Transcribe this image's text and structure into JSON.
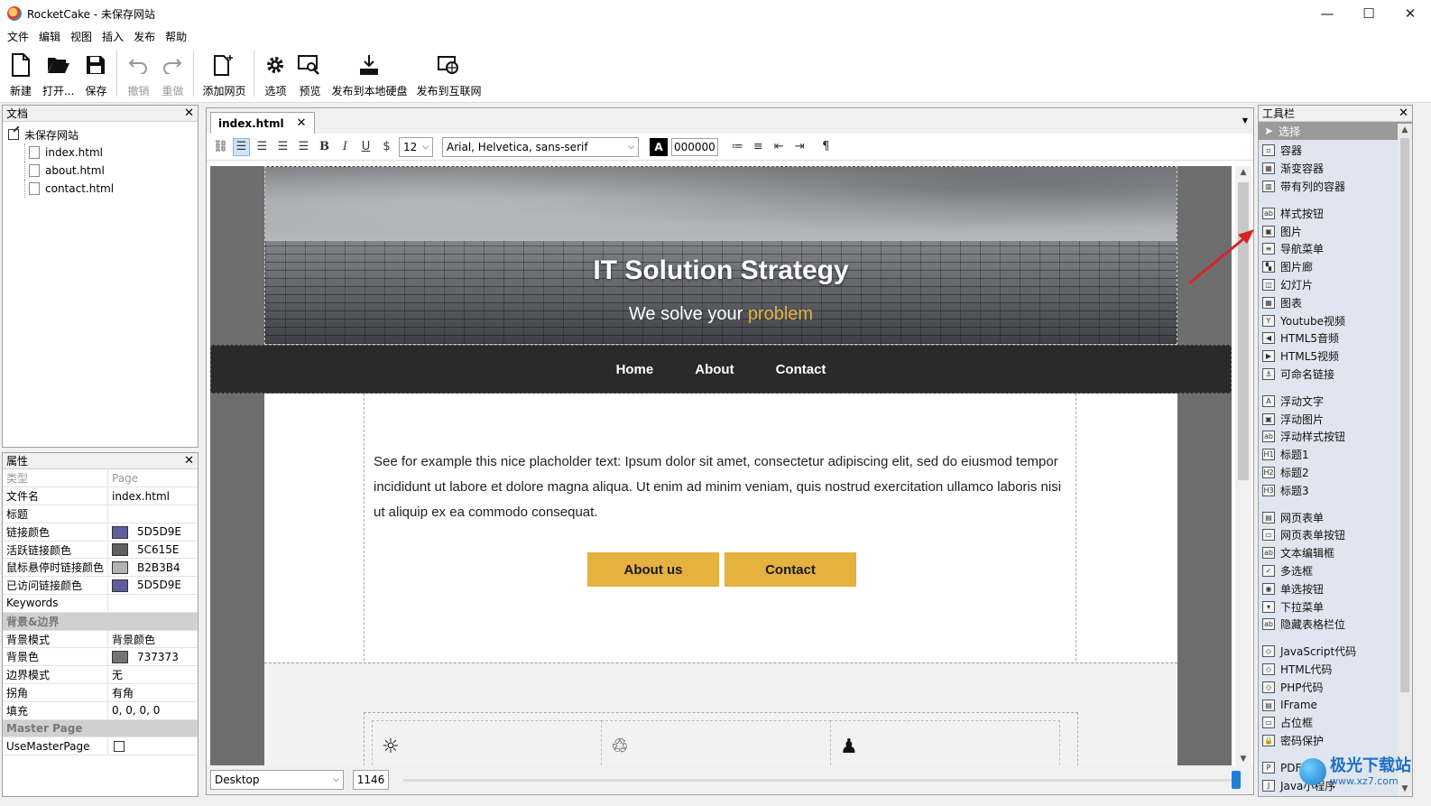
{
  "window": {
    "title": "RocketCake - 未保存网站",
    "controls": [
      "—",
      "☐",
      "✕"
    ]
  },
  "menu": [
    "文件",
    "编辑",
    "视图",
    "插入",
    "发布",
    "帮助"
  ],
  "toolbar": {
    "new": "新建",
    "open": "打开...",
    "save": "保存",
    "undo": "撤销",
    "redo": "重做",
    "add_page": "添加网页",
    "options": "选项",
    "preview": "预览",
    "publish_local": "发布到本地硬盘",
    "publish_web": "发布到互联网"
  },
  "documents_panel": {
    "title": "文档",
    "root": "未保存网站",
    "files": [
      "index.html",
      "about.html",
      "contact.html"
    ]
  },
  "properties_panel": {
    "title": "属性",
    "rows": [
      {
        "key": "类型",
        "value": "Page",
        "style": "grey"
      },
      {
        "key": "文件名",
        "value": "index.html"
      },
      {
        "key": "标题",
        "value": ""
      },
      {
        "key": "链接颜色",
        "value": "5D5D9E",
        "swatch": "#5D5D9E"
      },
      {
        "key": "活跃链接颜色",
        "value": "5C615E",
        "swatch": "#5C615E"
      },
      {
        "key": "鼠标悬停时链接颜色",
        "value": "B2B3B4",
        "swatch": "#B2B3B4"
      },
      {
        "key": "已访问链接颜色",
        "value": "5D5D9E",
        "swatch": "#5D5D9E"
      },
      {
        "key": "Keywords",
        "value": ""
      },
      {
        "key": "背景&边界",
        "value": "",
        "style": "section"
      },
      {
        "key": "背景模式",
        "value": "背景颜色"
      },
      {
        "key": "背景色",
        "value": "737373",
        "swatch": "#737373"
      },
      {
        "key": "边界模式",
        "value": "无"
      },
      {
        "key": "拐角",
        "value": "有角"
      },
      {
        "key": "填充",
        "value": "0, 0, 0, 0"
      },
      {
        "key": "Master Page",
        "value": "",
        "style": "section"
      },
      {
        "key": "UseMasterPage",
        "value": "",
        "checkbox": true
      }
    ]
  },
  "editor": {
    "tab": "index.html",
    "font_size": "12",
    "font_family": "Arial, Helvetica, sans-serif",
    "color_letter": "A",
    "color_value": "000000",
    "device": "Desktop",
    "width": "1146"
  },
  "site": {
    "hero_title": "IT Solution Strategy",
    "hero_sub_prefix": "We solve your ",
    "hero_sub_highlight": "problem",
    "nav": [
      "Home",
      "About",
      "Contact"
    ],
    "body_text": "See for example this nice placholder text: Ipsum dolor sit amet, consectetur adipiscing elit, sed do eiusmod tempor incididunt ut labore et dolore magna aliqua. Ut enim ad minim veniam, quis nostrud exercitation ullamco laboris nisi ut aliquip ex ea commodo consequat.",
    "button_about": "About us",
    "button_contact": "Contact",
    "accent_color": "#E5B13F"
  },
  "tools_panel": {
    "title": "工具栏",
    "selected": "选择",
    "groups": [
      [
        {
          "label": "容器",
          "icon": "container-icon"
        },
        {
          "label": "渐变容器",
          "icon": "gradient-container-icon"
        },
        {
          "label": "带有列的容器",
          "icon": "column-container-icon"
        }
      ],
      [
        {
          "label": "样式按钮",
          "icon": "style-button-icon"
        },
        {
          "label": "图片",
          "icon": "image-icon"
        },
        {
          "label": "导航菜单",
          "icon": "nav-menu-icon"
        },
        {
          "label": "图片廊",
          "icon": "gallery-icon"
        },
        {
          "label": "幻灯片",
          "icon": "slideshow-icon"
        },
        {
          "label": "图表",
          "icon": "table-icon"
        },
        {
          "label": "Youtube视频",
          "icon": "youtube-icon"
        },
        {
          "label": "HTML5音频",
          "icon": "audio-icon"
        },
        {
          "label": "HTML5视频",
          "icon": "video-icon"
        },
        {
          "label": "可命名链接",
          "icon": "anchor-icon"
        }
      ],
      [
        {
          "label": "浮动文字",
          "icon": "floating-text-icon"
        },
        {
          "label": "浮动图片",
          "icon": "floating-image-icon"
        },
        {
          "label": "浮动样式按钮",
          "icon": "floating-button-icon"
        },
        {
          "label": "标题1",
          "icon": "h1-icon"
        },
        {
          "label": "标题2",
          "icon": "h2-icon"
        },
        {
          "label": "标题3",
          "icon": "h3-icon"
        }
      ],
      [
        {
          "label": "网页表单",
          "icon": "form-icon"
        },
        {
          "label": "网页表单按钮",
          "icon": "form-button-icon"
        },
        {
          "label": "文本编辑框",
          "icon": "textbox-icon"
        },
        {
          "label": "多选框",
          "icon": "checkbox-icon"
        },
        {
          "label": "单选按钮",
          "icon": "radio-icon"
        },
        {
          "label": "下拉菜单",
          "icon": "dropdown-icon"
        },
        {
          "label": "隐藏表格栏位",
          "icon": "hidden-field-icon"
        }
      ],
      [
        {
          "label": "JavaScript代码",
          "icon": "javascript-icon"
        },
        {
          "label": "HTML代码",
          "icon": "html-code-icon"
        },
        {
          "label": "PHP代码",
          "icon": "php-icon"
        },
        {
          "label": "IFrame",
          "icon": "iframe-icon"
        },
        {
          "label": "占位框",
          "icon": "placeholder-icon"
        },
        {
          "label": "密码保护",
          "icon": "lock-icon"
        }
      ],
      [
        {
          "label": "PDF文档",
          "icon": "pdf-icon"
        },
        {
          "label": "Java小程序",
          "icon": "java-icon"
        }
      ]
    ]
  },
  "watermark": {
    "text": "极光下载站",
    "url": "www.xz7.com"
  }
}
